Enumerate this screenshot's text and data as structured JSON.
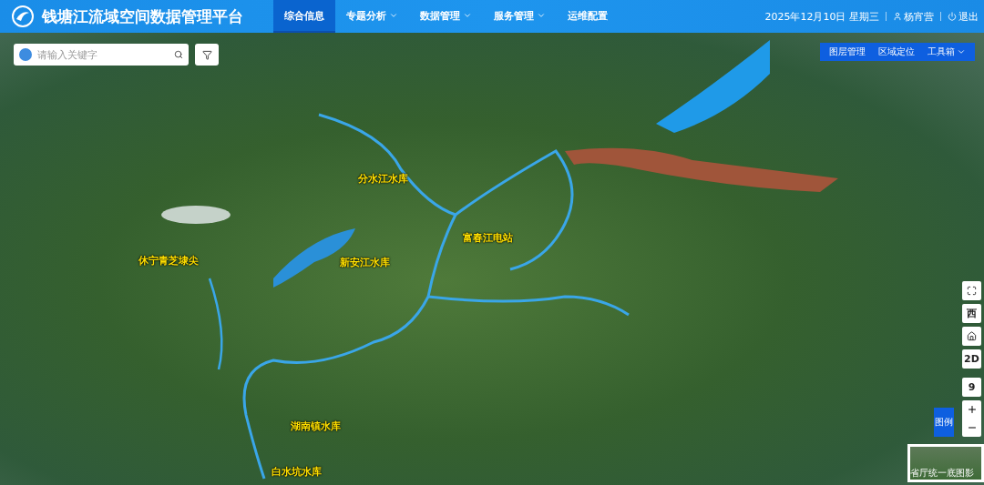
{
  "header": {
    "title": "钱塘江流域空间数据管理平台",
    "nav": [
      {
        "label": "综合信息",
        "selected": true,
        "dropdown": false
      },
      {
        "label": "专题分析",
        "selected": false,
        "dropdown": true
      },
      {
        "label": "数据管理",
        "selected": false,
        "dropdown": true
      },
      {
        "label": "服务管理",
        "selected": false,
        "dropdown": true
      },
      {
        "label": "运维配置",
        "selected": false,
        "dropdown": false
      }
    ],
    "date": "2025年12月10日 星期三",
    "user": "杨宵营",
    "logout": "退出"
  },
  "search": {
    "placeholder": "请输入关键字"
  },
  "toolbar": [
    {
      "label": "图层管理",
      "dropdown": false
    },
    {
      "label": "区域定位",
      "dropdown": false
    },
    {
      "label": "工具箱",
      "dropdown": true
    }
  ],
  "map_labels": [
    {
      "text": "分水江水库"
    },
    {
      "text": "富春江电站"
    },
    {
      "text": "休宁青芝埭尖"
    },
    {
      "text": "新安江水库"
    },
    {
      "text": "湖南镇水库"
    },
    {
      "text": "白水坑水库"
    }
  ],
  "map_controls": [
    {
      "kind": "fullscreen"
    },
    {
      "kind": "text",
      "label": "西"
    },
    {
      "kind": "home"
    },
    {
      "kind": "text",
      "label": "2D"
    }
  ],
  "zoom_level": "9",
  "legend": "图例",
  "basemap": {
    "label": "省厅统一底图影"
  }
}
